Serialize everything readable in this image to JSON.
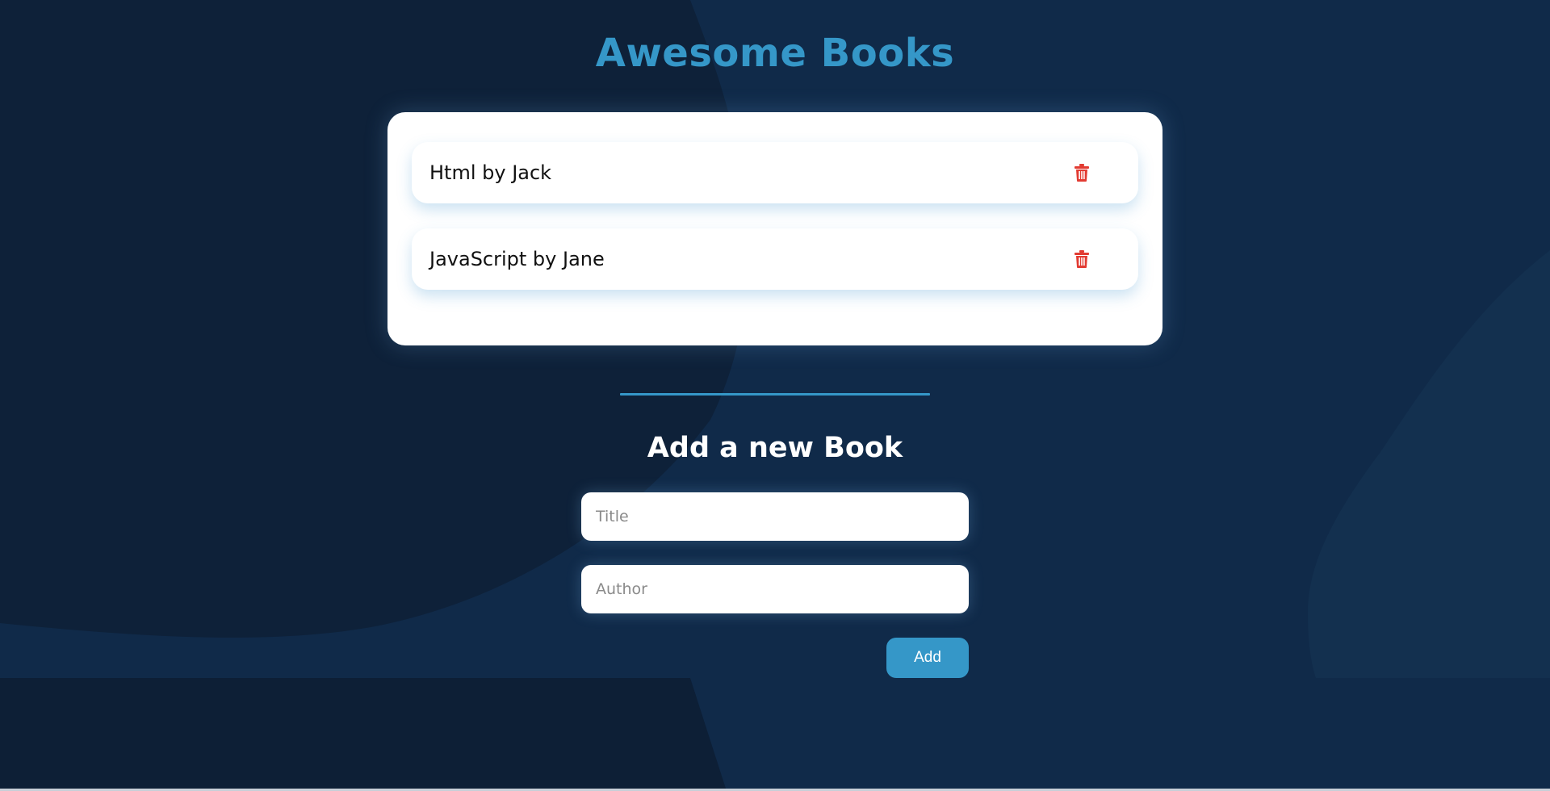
{
  "header": {
    "title": "Awesome Books"
  },
  "books": [
    {
      "text": "Html by Jack",
      "delete_icon": "trash-icon"
    },
    {
      "text": "JavaScript by Jane",
      "delete_icon": "trash-icon"
    }
  ],
  "form": {
    "title": "Add a new Book",
    "title_placeholder": "Title",
    "author_placeholder": "Author",
    "add_label": "Add"
  },
  "colors": {
    "background": "#0e2139",
    "accent": "#3597c8",
    "delete": "#e23b32",
    "card": "#ffffff"
  }
}
